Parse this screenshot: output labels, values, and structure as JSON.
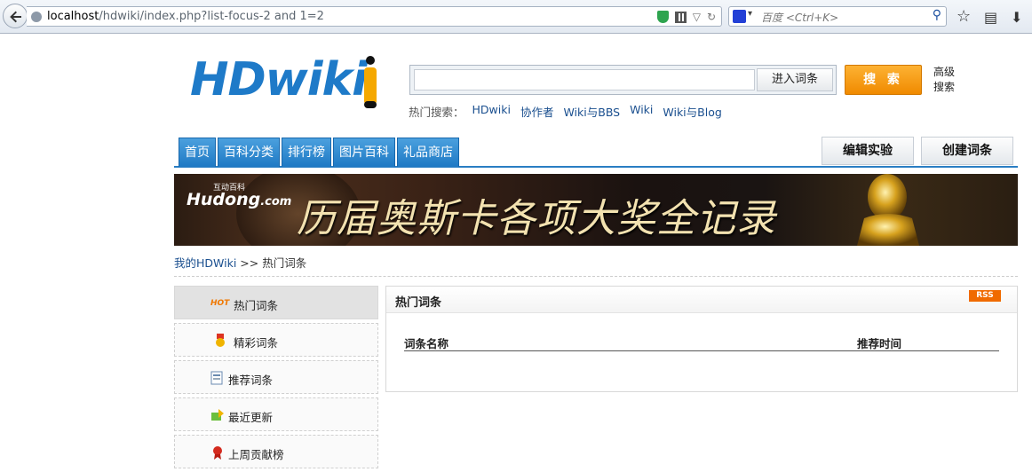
{
  "browser": {
    "url_host": "localhost",
    "url_path": "/hdwiki/index.php?list-focus-2 and 1=2",
    "search_placeholder": "百度 <Ctrl+K>"
  },
  "header": {
    "logo_text": "HDwiki",
    "search_input_value": "",
    "enter_entry_label": "进入词条",
    "search_button_label": "搜 索",
    "advanced_search_label": "高级搜索",
    "hot_search_label": "热门搜索：",
    "hot_search_links": [
      "HDwiki",
      "协作者",
      "Wiki与BBS",
      "Wiki",
      "Wiki与Blog"
    ]
  },
  "nav": {
    "tabs": [
      "首页",
      "百科分类",
      "排行榜",
      "图片百科",
      "礼品商店"
    ],
    "right_buttons": [
      "编辑实验",
      "创建词条"
    ]
  },
  "banner": {
    "brand": "Hudong",
    "brand_suffix": ".com",
    "brand_sub": "互动百科",
    "title": "历届奥斯卡各项大奖全记录"
  },
  "breadcrumb": {
    "home": "我的HDWiki",
    "separator": ">>",
    "current": "热门词条"
  },
  "sidebar": {
    "items": [
      {
        "label": "热门词条",
        "icon": "hot-icon",
        "badge": "HOT"
      },
      {
        "label": "精彩词条",
        "icon": "medal-icon"
      },
      {
        "label": "推荐词条",
        "icon": "document-icon"
      },
      {
        "label": "最近更新",
        "icon": "update-icon"
      },
      {
        "label": "上周贡献榜",
        "icon": "ribbon-icon"
      }
    ]
  },
  "panel": {
    "title": "热门词条",
    "rss_label": "RSS",
    "col_name": "词条名称",
    "col_time": "推荐时间"
  },
  "colors": {
    "nav_blue": "#1f79c4",
    "search_orange": "#f08a00",
    "link_blue": "#1a4f8f",
    "logo_blue": "#1e7ac8"
  }
}
